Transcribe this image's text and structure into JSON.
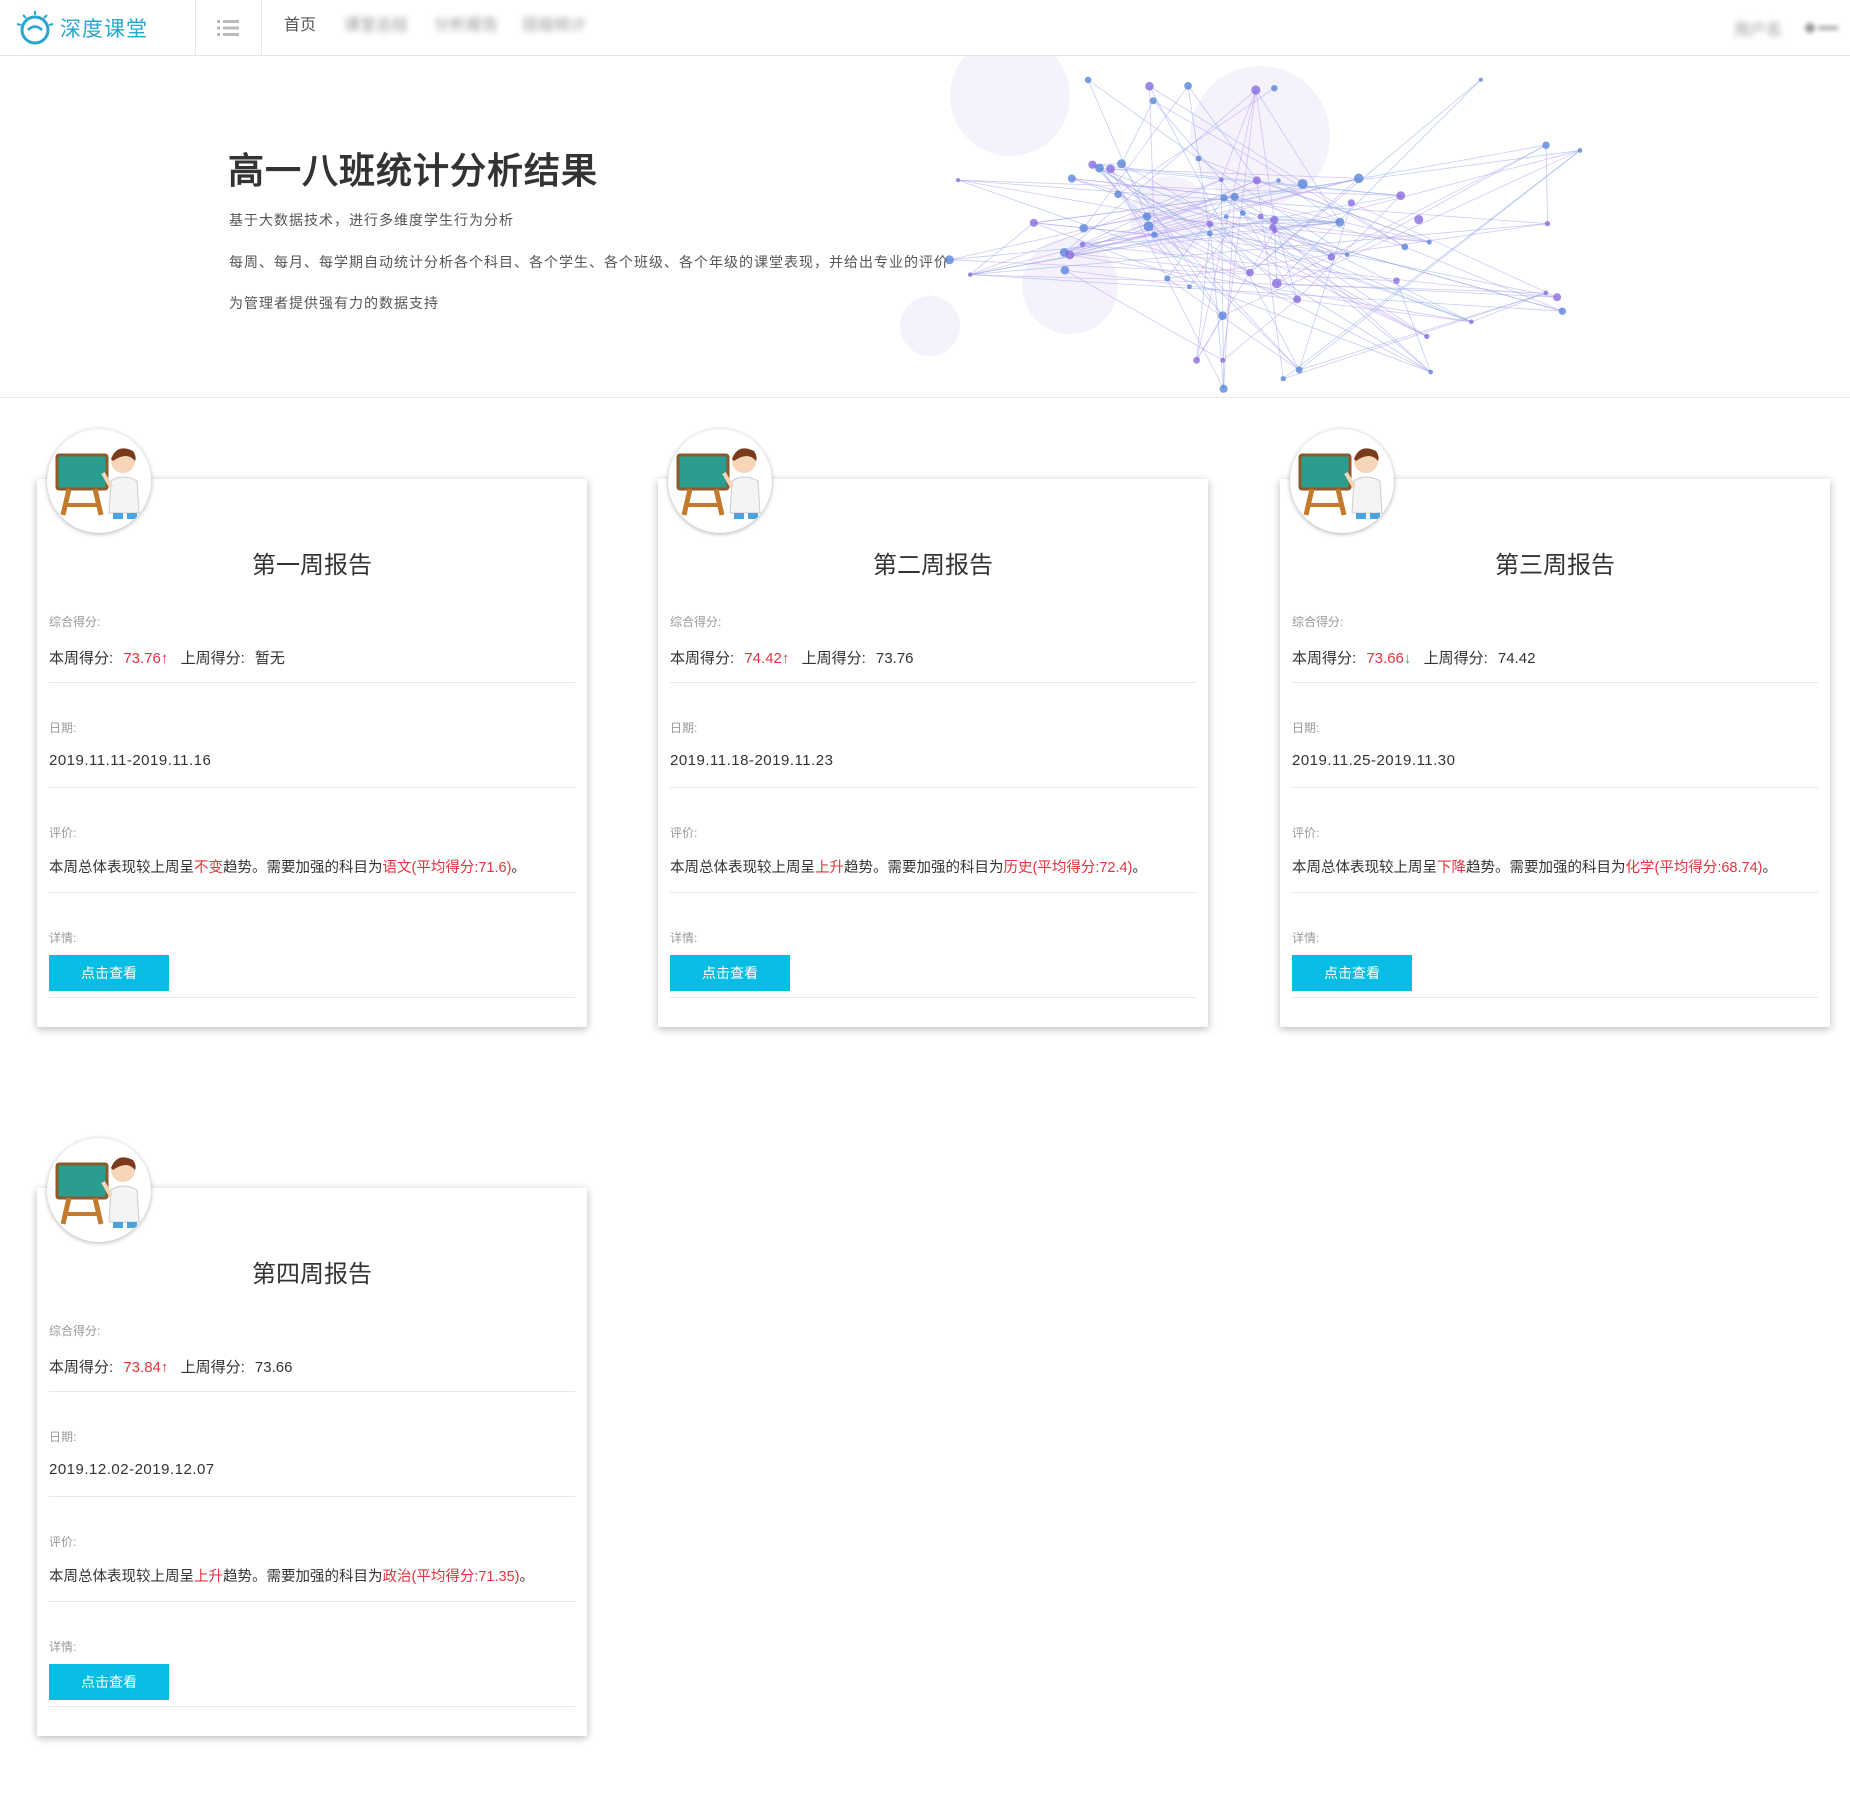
{
  "navbar": {
    "brand": "深度课堂",
    "home": "首页",
    "blurred_links": [
      "课堂总结",
      "分析报告",
      "班级统计"
    ],
    "blurred_user": "用户名"
  },
  "hero": {
    "title": "高一八班统计分析结果",
    "lines": [
      "基于大数据技术，进行多维度学生行为分析",
      "每周、每月、每学期自动统计分析各个科目、各个学生、各个班级、各个年级的课堂表现，并给出专业的评价",
      "为管理者提供强有力的数据支持"
    ]
  },
  "labels": {
    "score": "综合得分:",
    "this_week": "本周得分:",
    "last_week": "上周得分:",
    "date": "日期:",
    "eval": "评价:",
    "detail": "详情:",
    "button": "点击查看",
    "eval_prefix": "本周总体表现较上周呈",
    "eval_mid": "趋势。需要加强的科目为",
    "eval_end": "。"
  },
  "reports": [
    {
      "title": "第一周报告",
      "this_score": "73.76",
      "trend": "up",
      "trend_icon": "↑",
      "last_score": "暂无",
      "date": "2019.11.11-2019.11.16",
      "trend_word": "不变",
      "subject": "语文(平均得分:71.6)"
    },
    {
      "title": "第二周报告",
      "this_score": "74.42",
      "trend": "up",
      "trend_icon": "↑",
      "last_score": "73.76",
      "date": "2019.11.18-2019.11.23",
      "trend_word": "上升",
      "subject": "历史(平均得分:72.4)"
    },
    {
      "title": "第三周报告",
      "this_score": "73.66",
      "trend": "down",
      "trend_icon": "↓",
      "last_score": "74.42",
      "date": "2019.11.25-2019.11.30",
      "trend_word": "下降",
      "subject": "化学(平均得分:68.74)"
    },
    {
      "title": "第四周报告",
      "this_score": "73.84",
      "trend": "up",
      "trend_icon": "↑",
      "last_score": "73.66",
      "date": "2019.12.02-2019.12.07",
      "trend_word": "上升",
      "subject": "政治(平均得分:71.35)"
    }
  ],
  "colors": {
    "accent": "#08bde3",
    "highlight": "#e5323e",
    "down": "#2bb24c",
    "brand": "#28a6cf"
  }
}
